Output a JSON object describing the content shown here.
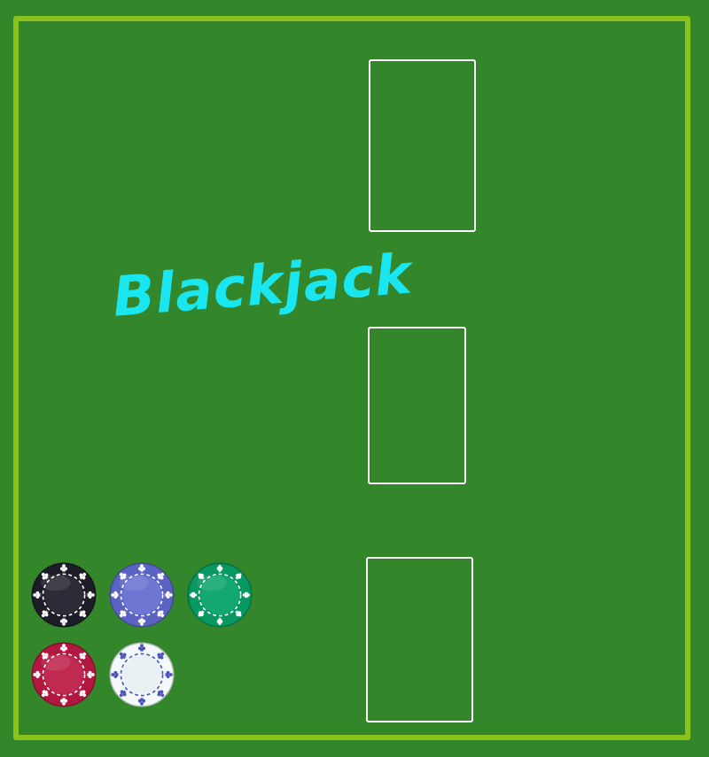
{
  "game": {
    "title": "Blackjack",
    "title_color": "#19e6ee"
  },
  "colors": {
    "felt": "#33862a",
    "border": "#8bc21c",
    "card_outline": "#ffffff"
  },
  "card_slots": [
    {
      "id": "dealer",
      "state": "empty"
    },
    {
      "id": "middle",
      "state": "empty"
    },
    {
      "id": "player",
      "state": "empty"
    }
  ],
  "chips": [
    {
      "name": "black",
      "color": "#1d1d27",
      "ring": "#2c2c38",
      "mark": "#ffffff",
      "icon": "club"
    },
    {
      "name": "blue",
      "color": "#5a63c4",
      "ring": "#6d76d2",
      "mark": "#ffffff",
      "icon": "club"
    },
    {
      "name": "green",
      "color": "#079761",
      "ring": "#13a872",
      "mark": "#ffffff",
      "icon": "spade"
    },
    {
      "name": "red",
      "color": "#b1173f",
      "ring": "#c02a50",
      "mark": "#ffffff",
      "icon": "club"
    },
    {
      "name": "white",
      "color": "#f4fafc",
      "ring": "#e8f0f4",
      "mark": "#4a55b8",
      "icon": "club"
    }
  ]
}
